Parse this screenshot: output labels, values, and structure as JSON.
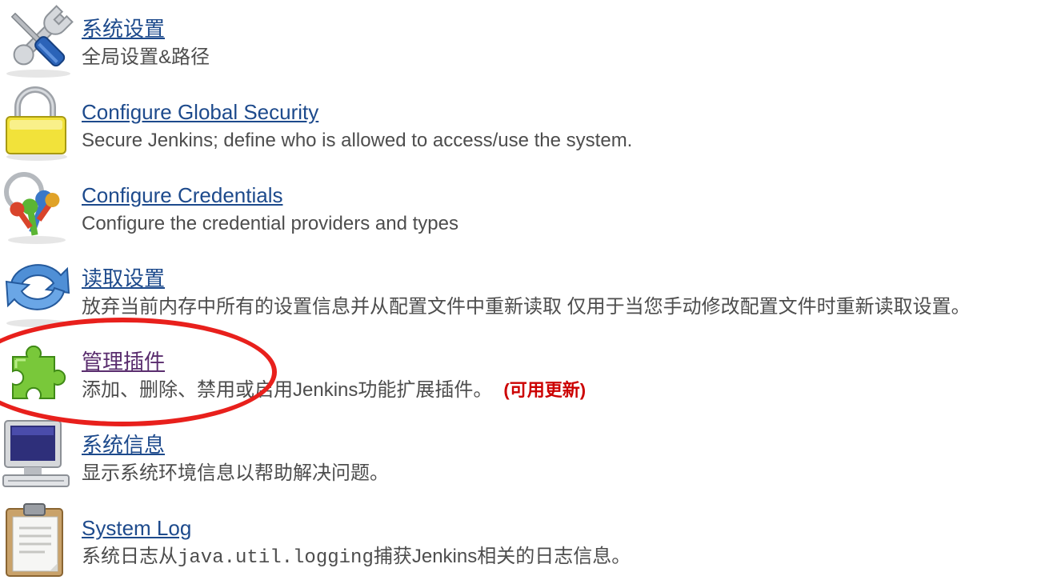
{
  "items": [
    {
      "icon": "wrench-screwdriver-icon",
      "title": "系统设置",
      "desc": "全局设置&路径"
    },
    {
      "icon": "padlock-icon",
      "title": "Configure Global Security",
      "desc": "Secure Jenkins; define who is allowed to access/use the system."
    },
    {
      "icon": "keys-icon",
      "title": "Configure Credentials",
      "desc": "Configure the credential providers and types"
    },
    {
      "icon": "reload-arrows-icon",
      "title": "读取设置",
      "desc": "放弃当前内存中所有的设置信息并从配置文件中重新读取 仅用于当您手动修改配置文件时重新读取设置。"
    },
    {
      "icon": "puzzle-piece-icon",
      "title": "管理插件",
      "desc": "添加、删除、禁用或启用Jenkins功能扩展插件。",
      "badge": "(可用更新)"
    },
    {
      "icon": "computer-monitor-icon",
      "title": "系统信息",
      "desc": "显示系统环境信息以帮助解决问题。"
    },
    {
      "icon": "clipboard-icon",
      "title": "System Log",
      "desc_prefix": "系统日志从",
      "desc_mono": "java.util.logging",
      "desc_suffix": "捕获Jenkins相关的日志信息。"
    }
  ],
  "colors": {
    "link": "#1d4a8c",
    "visited_link": "#5a2d6e",
    "desc_text": "#4d4d4d",
    "update_badge": "#cc0000",
    "highlight_ellipse": "#e8201c"
  }
}
